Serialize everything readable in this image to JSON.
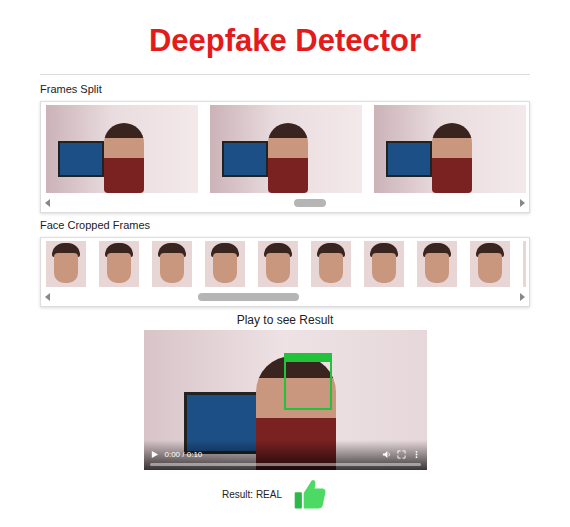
{
  "title": "Deepfake Detector",
  "frames_split": {
    "label": "Frames Split",
    "frames": [
      {
        "kind": "photo"
      },
      {
        "kind": "photo"
      },
      {
        "kind": "photo"
      }
    ],
    "scrollbar": {
      "thumb_start": 0.52,
      "thumb_size": 0.07
    }
  },
  "face_frames": {
    "label": "Face Cropped Frames",
    "frames": [
      {
        "kind": "photo"
      },
      {
        "kind": "photo"
      },
      {
        "kind": "photo"
      },
      {
        "kind": "photo"
      },
      {
        "kind": "photo"
      },
      {
        "kind": "photo"
      },
      {
        "kind": "photo"
      },
      {
        "kind": "photo"
      },
      {
        "kind": "photo"
      },
      {
        "kind": "photo"
      }
    ],
    "scrollbar": {
      "thumb_start": 0.31,
      "thumb_size": 0.22
    }
  },
  "player": {
    "caption": "Play to see Result",
    "time": "0:00 / 0:10",
    "level": 0
  },
  "result": {
    "label": "Result: REAL"
  }
}
